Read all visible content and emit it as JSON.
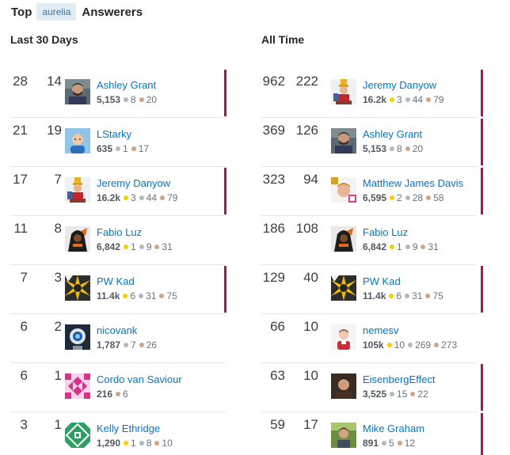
{
  "header": {
    "title_prefix": "Top",
    "tag": "aurelia",
    "title_suffix": "Answerers"
  },
  "columns": [
    {
      "heading": "Last 30 Days",
      "rows": [
        {
          "n1": "28",
          "n2": "14",
          "name": "Ashley Grant",
          "score": "5,153",
          "gold": "",
          "silver": "8",
          "bronze": "20",
          "avatar": "photo-avatar",
          "accent": true
        },
        {
          "n1": "21",
          "n2": "19",
          "name": "LStarky",
          "score": "635",
          "gold": "",
          "silver": "1",
          "bronze": "17",
          "avatar": "cartoon-avatar",
          "accent": false
        },
        {
          "n1": "17",
          "n2": "7",
          "name": "Jeremy Danyow",
          "score": "16.2k",
          "gold": "3",
          "silver": "44",
          "bronze": "79",
          "avatar": "character-avatar",
          "accent": true
        },
        {
          "n1": "11",
          "n2": "8",
          "name": "Fabio Luz",
          "score": "6,842",
          "gold": "1",
          "silver": "9",
          "bronze": "31",
          "avatar": "dark-avatar",
          "accent": false
        },
        {
          "n1": "7",
          "n2": "3",
          "name": "PW Kad",
          "score": "11.4k",
          "gold": "6",
          "silver": "31",
          "bronze": "75",
          "avatar": "burst-avatar",
          "accent": true
        },
        {
          "n1": "6",
          "n2": "2",
          "name": "nicovank",
          "score": "1,787",
          "gold": "",
          "silver": "7",
          "bronze": "26",
          "avatar": "robot-avatar",
          "accent": false
        },
        {
          "n1": "6",
          "n2": "1",
          "name": "Cordo van Saviour",
          "score": "216",
          "gold": "",
          "silver": "",
          "bronze": "6",
          "avatar": "pink-identicon",
          "accent": false
        },
        {
          "n1": "3",
          "n2": "1",
          "name": "Kelly Ethridge",
          "score": "1,290",
          "gold": "1",
          "silver": "8",
          "bronze": "10",
          "avatar": "green-identicon",
          "accent": false
        }
      ]
    },
    {
      "heading": "All Time",
      "rows": [
        {
          "n1": "962",
          "n2": "222",
          "name": "Jeremy Danyow",
          "score": "16.2k",
          "gold": "3",
          "silver": "44",
          "bronze": "79",
          "avatar": "character-avatar",
          "accent": true
        },
        {
          "n1": "369",
          "n2": "126",
          "name": "Ashley Grant",
          "score": "5,153",
          "gold": "",
          "silver": "8",
          "bronze": "20",
          "avatar": "photo-avatar",
          "accent": true
        },
        {
          "n1": "323",
          "n2": "94",
          "name": "Matthew James Davis",
          "score": "6,595",
          "gold": "2",
          "silver": "28",
          "bronze": "58",
          "avatar": "selfie-avatar",
          "accent": true
        },
        {
          "n1": "186",
          "n2": "108",
          "name": "Fabio Luz",
          "score": "6,842",
          "gold": "1",
          "silver": "9",
          "bronze": "31",
          "avatar": "dark-avatar",
          "accent": false
        },
        {
          "n1": "129",
          "n2": "40",
          "name": "PW Kad",
          "score": "11.4k",
          "gold": "6",
          "silver": "31",
          "bronze": "75",
          "avatar": "burst-avatar",
          "accent": true
        },
        {
          "n1": "66",
          "n2": "10",
          "name": "nemesv",
          "score": "105k",
          "gold": "10",
          "silver": "269",
          "bronze": "273",
          "avatar": "portrait-avatar",
          "accent": false
        },
        {
          "n1": "63",
          "n2": "10",
          "name": "EisenbergEffect",
          "score": "3,525",
          "gold": "",
          "silver": "15",
          "bronze": "22",
          "avatar": "man-avatar",
          "accent": true
        },
        {
          "n1": "59",
          "n2": "17",
          "name": "Mike Graham",
          "score": "891",
          "gold": "",
          "silver": "5",
          "bronze": "12",
          "avatar": "outdoor-avatar",
          "accent": true
        }
      ]
    }
  ],
  "colors": {
    "link": "#0077cc",
    "accent": "#a4155c",
    "tag_bg": "#e1ecf4",
    "tag_fg": "#39739d",
    "gold": "#ffcc01",
    "silver": "#b4b8bc",
    "bronze": "#d1a684"
  }
}
